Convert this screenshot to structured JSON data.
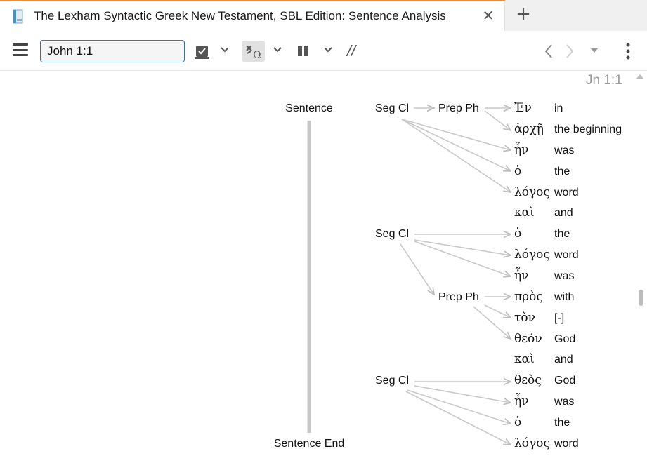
{
  "tab": {
    "title": "The Lexham Syntactic Greek New Testament, SBL Edition: Sentence Analysis",
    "close_glyph": "✕",
    "add_glyph": "+"
  },
  "toolbar": {
    "reference_value": "John 1:1",
    "interlinear_symbol": "//"
  },
  "passage_label": "Jn 1:1",
  "tree": {
    "sentence_label": "Sentence",
    "sentence_end_label": "Sentence End",
    "clauses": [
      {
        "label": "Seg Cl",
        "phrase": "Prep Ph"
      },
      {
        "label": "Seg Cl",
        "phrase": "Prep Ph"
      },
      {
        "label": "Seg Cl"
      }
    ],
    "words": [
      {
        "greek": "Ἐν",
        "gloss": "in"
      },
      {
        "greek": "ἀρχῇ",
        "gloss": "the beginning"
      },
      {
        "greek": "ἦν",
        "gloss": "was"
      },
      {
        "greek": "ὁ",
        "gloss": "the"
      },
      {
        "greek": "λόγος",
        "gloss": "word"
      },
      {
        "greek": "καὶ",
        "gloss": "and"
      },
      {
        "greek": "ὁ",
        "gloss": "the"
      },
      {
        "greek": "λόγος",
        "gloss": "word"
      },
      {
        "greek": "ἦν",
        "gloss": "was"
      },
      {
        "greek": "πρὸς",
        "gloss": "with"
      },
      {
        "greek": "τὸν",
        "gloss": "[-]"
      },
      {
        "greek": "θεόν",
        "gloss": "God"
      },
      {
        "greek": "καὶ",
        "gloss": "and"
      },
      {
        "greek": "θεὸς",
        "gloss": "God"
      },
      {
        "greek": "ἦν",
        "gloss": "was"
      },
      {
        "greek": "ὁ",
        "gloss": "the"
      },
      {
        "greek": "λόγος",
        "gloss": "word"
      }
    ]
  }
}
